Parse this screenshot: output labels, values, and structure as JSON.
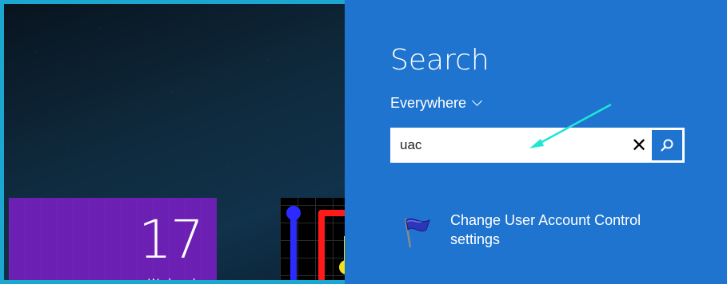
{
  "start_screen": {
    "calendar_tile": {
      "day": "17",
      "weekday": "Wednesday"
    },
    "game_tile": {}
  },
  "search_pane": {
    "title": "Search",
    "scope": {
      "label": "Everywhere",
      "icon": "chevron-down-icon"
    },
    "search_box": {
      "value": "uac",
      "clear_icon": "close-icon",
      "go_icon": "search-icon"
    },
    "results": [
      {
        "label": "Change User Account Control settings",
        "icon": "uac-flag-icon"
      }
    ]
  },
  "annotation": {
    "arrow_color": "#1ee6d6"
  },
  "colors": {
    "pane": "#1f74d0",
    "frame": "#1ba7cf",
    "calendar_tile": "#6c1fb3"
  }
}
